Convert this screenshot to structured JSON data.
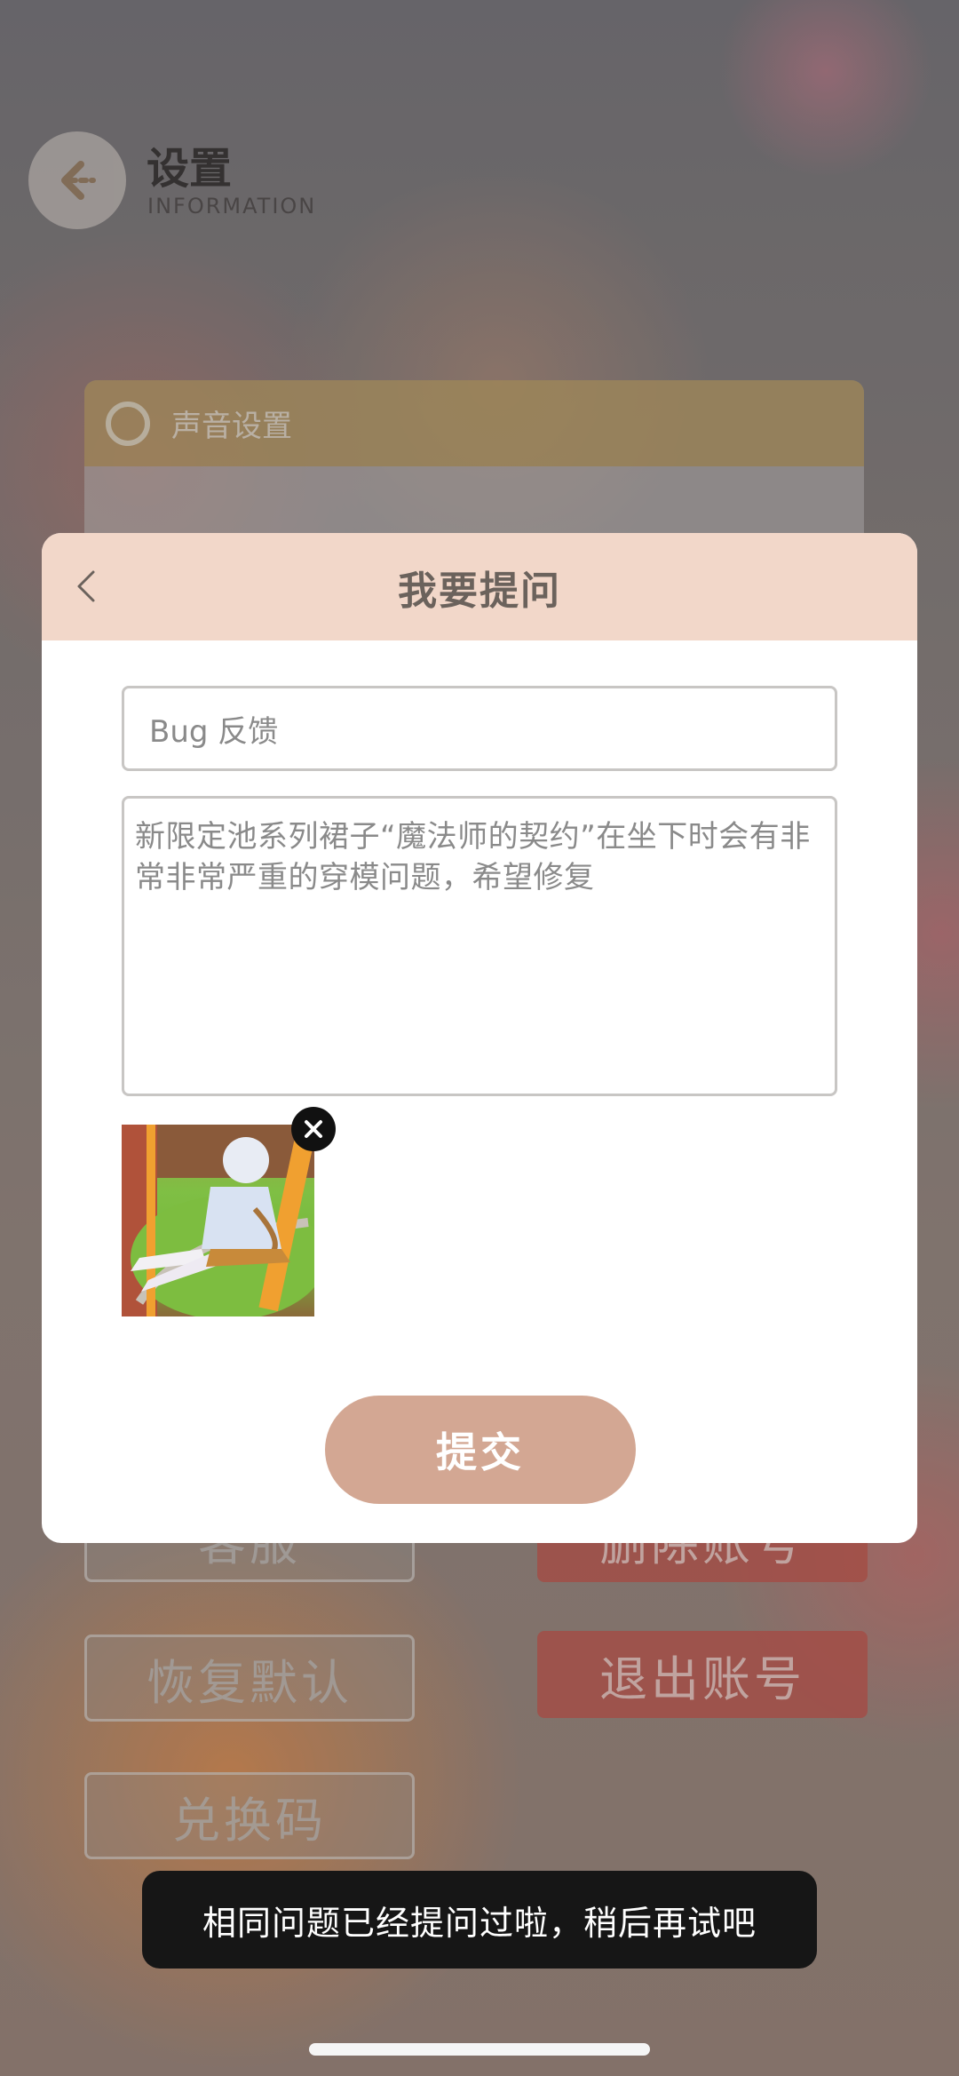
{
  "background_page": {
    "title": "设置",
    "subtitle": "INFORMATION",
    "sound_settings_label": "声音设置",
    "buttons": {
      "customer_service": "客服",
      "delete_account": "删除账号",
      "restore_default": "恢复默认",
      "logout": "退出账号",
      "redeem_code": "兑换码"
    }
  },
  "dialog": {
    "title": "我要提问",
    "question_title": "Bug 反馈",
    "question_body": "新限定池系列裙子“魔法师的契约”在坐下时会有非常非常严重的穿模问题，希望修复",
    "submit_label": "提交"
  },
  "toast": {
    "message": "相同问题已经提问过啦，稍后再试吧"
  },
  "colors": {
    "header_bg": "#f2d7c9",
    "submit_bg": "#d3a793",
    "logout_bg": "#c85c54",
    "toast_bg": "#161616"
  },
  "icons": [
    "back-arrow-icon",
    "sound-icon",
    "chevron-left-icon",
    "close-icon"
  ]
}
